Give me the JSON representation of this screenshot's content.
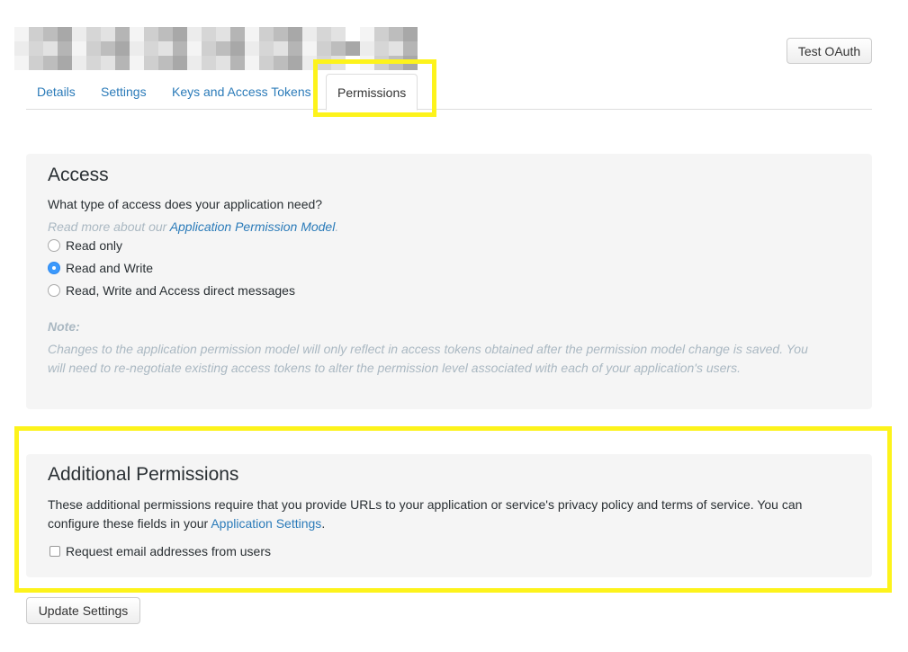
{
  "header": {
    "test_oauth_label": "Test OAuth"
  },
  "tabs": [
    {
      "label": "Details"
    },
    {
      "label": "Settings"
    },
    {
      "label": "Keys and Access Tokens"
    },
    {
      "label": "Permissions",
      "active": true
    }
  ],
  "access": {
    "title": "Access",
    "question": "What type of access does your application need?",
    "read_more_prefix": "Read more about our ",
    "read_more_link": "Application Permission Model",
    "read_more_suffix": ".",
    "options": [
      {
        "label": "Read only",
        "checked": false
      },
      {
        "label": "Read and Write",
        "checked": true
      },
      {
        "label": "Read, Write and Access direct messages",
        "checked": false
      }
    ],
    "note_label": "Note:",
    "note_line1": "Changes to the application permission model will only reflect in access tokens obtained after the permission model change is saved. You",
    "note_line2": "will need to re-negotiate existing access tokens to alter the permission level associated with each of your application's users."
  },
  "additional": {
    "title": "Additional Permissions",
    "desc_line1": "These additional permissions require that you provide URLs to your application or service's privacy policy and terms of service. You can",
    "desc_line2_prefix": "configure these fields in your ",
    "desc_line2_link": "Application Settings",
    "desc_line2_suffix": ".",
    "checkbox_label": "Request email addresses from users",
    "checkbox_checked": false
  },
  "footer": {
    "update_label": "Update Settings"
  },
  "colors": {
    "link": "#2b7bb9",
    "highlight": "#fdf31b",
    "radio_checked": "#3b99fc"
  }
}
